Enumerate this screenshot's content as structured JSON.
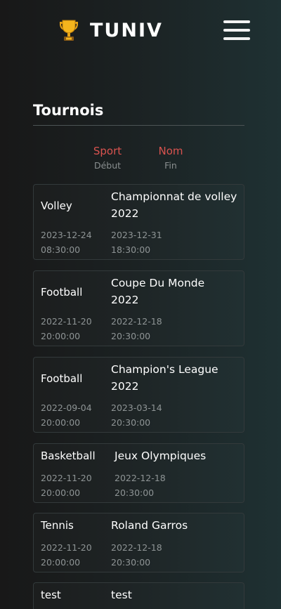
{
  "app": {
    "brand": "TUNIV",
    "logo_icon": "trophy-icon",
    "menu_icon": "hamburger-menu-icon"
  },
  "page": {
    "title": "Tournois"
  },
  "sort": {
    "sport": {
      "label": "Sport",
      "sub": "Début"
    },
    "name": {
      "label": "Nom",
      "sub": "Fin"
    }
  },
  "colors": {
    "accent": "#d9534f",
    "muted": "#8e9495"
  },
  "tournaments": [
    {
      "sport": "Volley",
      "name": "Championnat de volley 2022",
      "start": "2023-12-24 08:30:00",
      "end": "2023-12-31 18:30:00"
    },
    {
      "sport": "Football",
      "name": "Coupe Du Monde 2022",
      "start": "2022-11-20 20:00:00",
      "end": "2022-12-18 20:30:00"
    },
    {
      "sport": "Football",
      "name": "Champion's League 2022",
      "start": "2022-09-04 20:00:00",
      "end": "2023-03-14 20:30:00"
    },
    {
      "sport": "Basketball",
      "name": "Jeux Olympiques",
      "start": "2022-11-20 20:00:00",
      "end": "2022-12-18 20:30:00"
    },
    {
      "sport": "Tennis",
      "name": "Roland Garros",
      "start": "2022-11-20 20:00:00",
      "end": "2022-12-18 20:30:00"
    },
    {
      "sport": "test",
      "name": "test",
      "start": "",
      "end": ""
    }
  ]
}
